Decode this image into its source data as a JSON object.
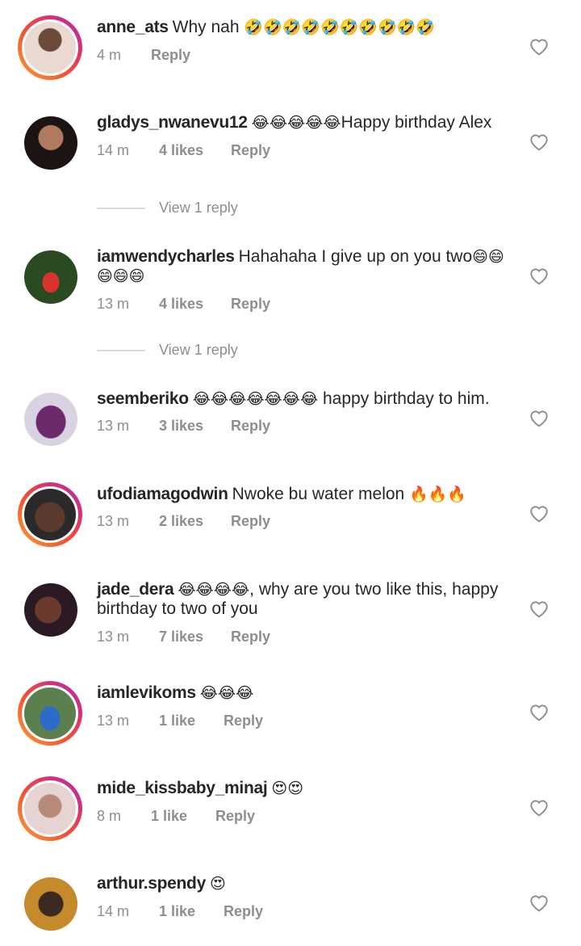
{
  "comments": [
    {
      "username": "anne_ats",
      "text": "Why nah",
      "emoji": "🤣🤣🤣🤣🤣🤣🤣🤣🤣🤣",
      "emoji_after": "",
      "time": "4 m",
      "likes": "",
      "reply": "Reply",
      "avatar_ring": true,
      "avatar_color": "#d9c4b8"
    },
    {
      "username": "gladys_nwanevu12",
      "text": "",
      "emoji": "😂😂😂😂😂",
      "emoji_after": "Happy birthday Alex",
      "time": "14 m",
      "likes": "4 likes",
      "reply": "Reply",
      "avatar_ring": false,
      "avatar_color": "#3a2d2a"
    },
    {
      "username": "iamwendycharles",
      "text": "Hahahaha I give up on you two",
      "emoji": "😄😄",
      "line2_emoji": "😄😄😄",
      "time": "13 m",
      "likes": "4 likes",
      "reply": "Reply",
      "avatar_ring": false,
      "avatar_color": "#1f3d1d"
    },
    {
      "username": "seemberiko",
      "text": "",
      "emoji": "😂😂😂😂😂😂😂",
      "emoji_after": " happy birthday to him.",
      "time": "13 m",
      "likes": "3 likes",
      "reply": "Reply",
      "avatar_ring": false,
      "avatar_color": "#c9c1d6"
    },
    {
      "username": "ufodiamagodwin",
      "text": "Nwoke bu water melon",
      "emoji": "🔥🔥🔥",
      "emoji_after": "",
      "time": "13 m",
      "likes": "2 likes",
      "reply": "Reply",
      "avatar_ring": true,
      "avatar_color": "#4e3a32"
    },
    {
      "username": "jade_dera",
      "text": "",
      "emoji": "😂😂😂😂",
      "emoji_after": ", why are you two like this, happy",
      "line2": "birthday to two of you",
      "time": "13 m",
      "likes": "7 likes",
      "reply": "Reply",
      "avatar_ring": false,
      "avatar_color": "#2c1b22"
    },
    {
      "username": "iamlevikoms",
      "text": "",
      "emoji": "😂😂😂",
      "emoji_after": "",
      "time": "13 m",
      "likes": "1 like",
      "reply": "Reply",
      "avatar_ring": true,
      "avatar_color": "#5c7f4f"
    },
    {
      "username": "mide_kissbaby_minaj",
      "text": "",
      "emoji": "😍😍",
      "emoji_after": "",
      "time": "8 m",
      "likes": "1 like",
      "reply": "Reply",
      "avatar_ring": true,
      "avatar_color": "#c5a6a4"
    },
    {
      "username": "arthur.spendy",
      "text": "",
      "emoji": "😍",
      "emoji_after": "",
      "time": "14 m",
      "likes": "1 like",
      "reply": "Reply",
      "avatar_ring": false,
      "avatar_color": "#c58a2a"
    }
  ],
  "view_replies": [
    "View 1 reply",
    "View 1 reply"
  ],
  "colors": {
    "text": "#262626",
    "meta": "#8e8e8e",
    "ring_start": "#f9a23a",
    "ring_end": "#a432b8"
  }
}
